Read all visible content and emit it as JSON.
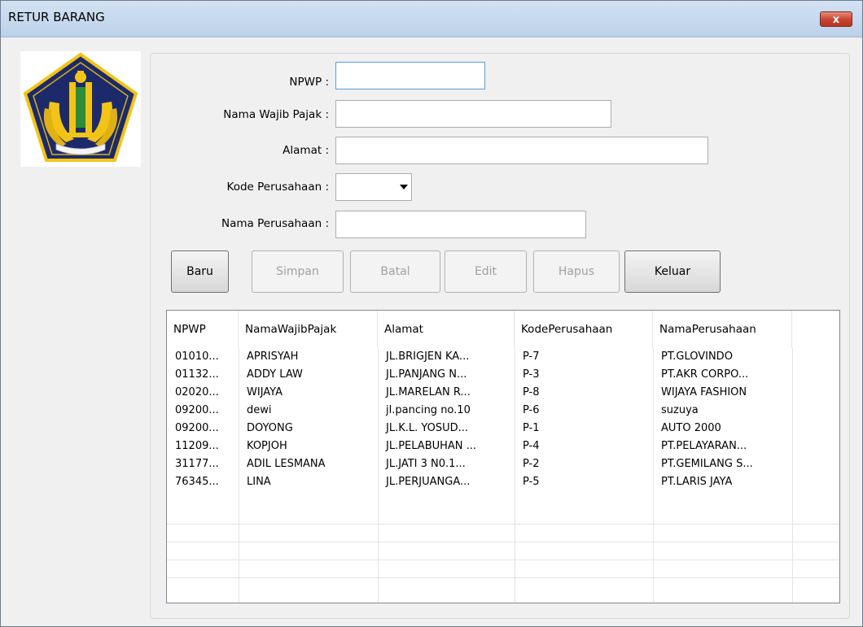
{
  "window": {
    "title": "RETUR BARANG",
    "close_glyph": "x"
  },
  "form": {
    "npwp": {
      "label": "NPWP :",
      "value": ""
    },
    "nama_wajib_pajak": {
      "label": "Nama Wajib Pajak :",
      "value": ""
    },
    "alamat": {
      "label": "Alamat :",
      "value": ""
    },
    "kode_perusahaan": {
      "label": "Kode Perusahaan :",
      "value": ""
    },
    "nama_perusahaan": {
      "label": "Nama Perusahaan :",
      "value": ""
    }
  },
  "buttons": {
    "baru": "Baru",
    "simpan": "Simpan",
    "batal": "Batal",
    "edit": "Edit",
    "hapus": "Hapus",
    "keluar": "Keluar"
  },
  "table": {
    "columns": [
      "NPWP",
      "NamaWajibPajak",
      "Alamat",
      "KodePerusahaan",
      "NamaPerusahaan"
    ],
    "rows": [
      [
        "01010...",
        "APRISYAH",
        "JL.BRIGJEN KA...",
        "P-7",
        "PT.GLOVINDO"
      ],
      [
        "01132...",
        "ADDY LAW",
        "JL.PANJANG N...",
        "P-3",
        "PT.AKR CORPO..."
      ],
      [
        "02020...",
        "WIJAYA",
        "JL.MARELAN R...",
        "P-8",
        "WIJAYA FASHION"
      ],
      [
        "09200...",
        "dewi",
        "jl.pancing no.10",
        "P-6",
        "suzuya"
      ],
      [
        "09200...",
        "DOYONG",
        "JL.K.L. YOSUD...",
        "P-1",
        "AUTO 2000"
      ],
      [
        "11209...",
        "KOPJOH",
        "JL.PELABUHAN ...",
        "P-4",
        "PT.PELAYARAN..."
      ],
      [
        "31177...",
        "ADIL LESMANA",
        "JL.JATI 3 N0.1...",
        "P-2",
        "PT.GEMILANG S..."
      ],
      [
        "76345...",
        "LINA",
        "JL.PERJUANGA...",
        "P-5",
        "PT.LARIS JAYA"
      ]
    ]
  },
  "logo": {
    "icon": "kemenkeu-emblem-icon",
    "colors": {
      "navy": "#1c2a6b",
      "gold": "#f2c417",
      "green": "#2e8b3a"
    }
  }
}
